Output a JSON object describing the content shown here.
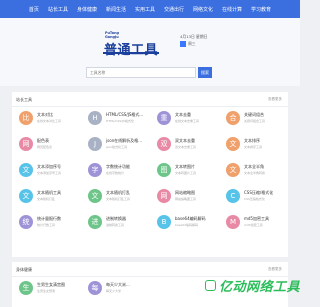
{
  "nav": [
    "首页",
    "站长工具",
    "身体健康",
    "新闻生活",
    "实用工具",
    "交通出行",
    "网络文化",
    "在线计算",
    "学习教育"
  ],
  "logo": {
    "small_line1": "PuTong",
    "small_line2": "GongJu",
    "title": "普通工具"
  },
  "date": "4月13日 星期日",
  "weekday": "周三",
  "search": {
    "placeholder": "工具名称",
    "button": "搜索"
  },
  "sections": [
    {
      "title": "站长工具",
      "more": "查看更多",
      "tools": [
        {
          "char": "比",
          "color": "#f0a06b",
          "title": "文本对比",
          "desc": "在线文本对比工具"
        },
        {
          "char": "H",
          "color": "#a9b2c4",
          "title": "HTML/CSS/JS格式...",
          "desc": "HTML/CSS/JS格式化"
        },
        {
          "char": "重",
          "color": "#9f93d8",
          "title": "文本去重",
          "desc": "在线文本去重工具"
        },
        {
          "char": "合",
          "color": "#f0a06b",
          "title": "关键词组合",
          "desc": "关键词组合工具"
        },
        {
          "char": "网",
          "color": "#e88aa5",
          "title": "配色表",
          "desc": "网页配色表"
        },
        {
          "char": "J",
          "color": "#a9b2c4",
          "title": "json在线解析及格...",
          "desc": "json格式化工具"
        },
        {
          "char": "双",
          "color": "#e88aa5",
          "title": "双文本去重",
          "desc": "双文本去重工具"
        },
        {
          "char": "文",
          "color": "#f0a06b",
          "title": "文本排序",
          "desc": "文本排序工具"
        },
        {
          "char": "文",
          "color": "#57c3e8",
          "title": "文本添加序号",
          "desc": "文本添加序号工具"
        },
        {
          "char": "字",
          "color": "#9f93d8",
          "title": "字数统计功能",
          "desc": "在线字数统计"
        },
        {
          "char": "图",
          "color": "#6ec58a",
          "title": "文本转图片",
          "desc": "文本转图片工具"
        },
        {
          "char": "文",
          "color": "#f0a06b",
          "title": "文本全半角",
          "desc": "文本全半角转换"
        },
        {
          "char": "文",
          "color": "#57c3e8",
          "title": "文本随机工具",
          "desc": "文本随机打乱"
        },
        {
          "char": "文",
          "color": "#6ec58a",
          "title": "文本随机打乱",
          "desc": "文本随机打乱工具"
        },
        {
          "char": "网",
          "color": "#e88aa5",
          "title": "网站缩略图",
          "desc": "网站缩略图工具"
        },
        {
          "char": "C",
          "color": "#57c3e8",
          "title": "CSS压缩/格式化",
          "desc": "CSS压缩格式化"
        },
        {
          "char": "统",
          "color": "#9f93d8",
          "title": "统计量报行数",
          "desc": "统计行数工具"
        },
        {
          "char": "进",
          "color": "#6ec58a",
          "title": "进制转换器",
          "desc": "进制转换工具"
        },
        {
          "char": "B",
          "color": "#57c3e8",
          "title": "base64编码解码",
          "desc": "base64编码解码"
        },
        {
          "char": "M",
          "color": "#e88aa5",
          "title": "md5加密工具",
          "desc": "md5加密工具"
        }
      ]
    },
    {
      "title": "身体健康",
      "more": "查看更多",
      "tools": [
        {
          "char": "生",
          "color": "#6ec58a",
          "title": "生男生女清宫图",
          "desc": "生男生女预测"
        },
        {
          "char": "每",
          "color": "#9f93d8",
          "title": "每天少大米...",
          "desc": "每天少大米"
        }
      ]
    }
  ],
  "watermark": "亿动网络工具"
}
